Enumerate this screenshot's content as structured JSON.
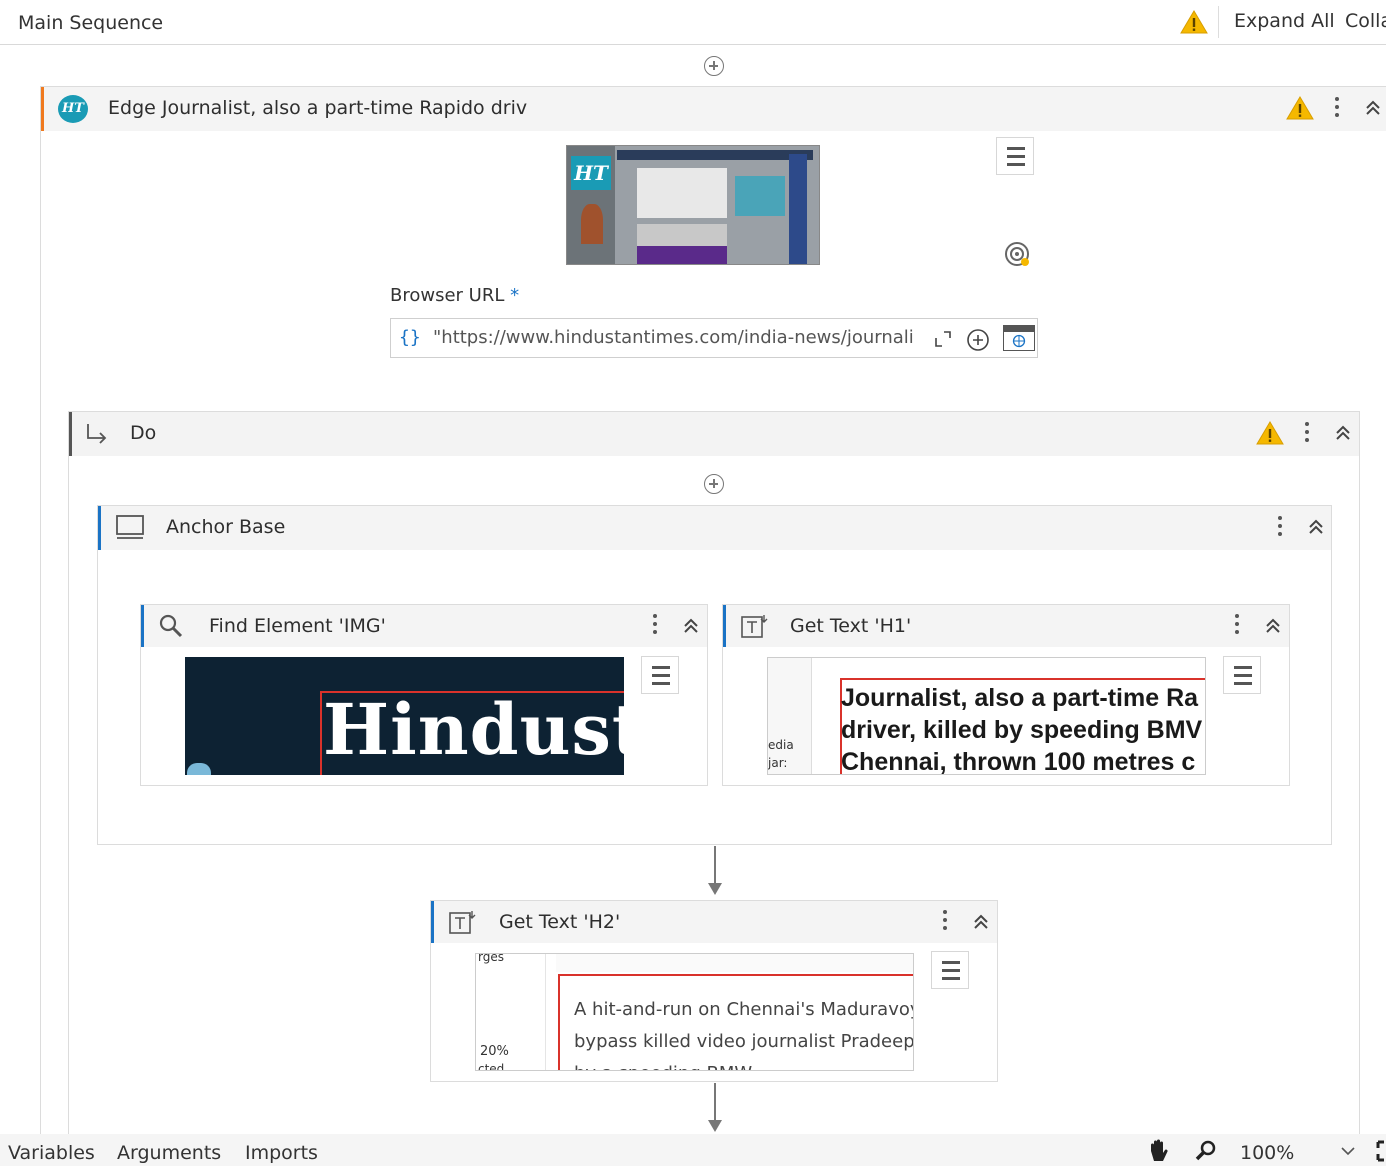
{
  "topbar": {
    "title": "Main Sequence",
    "expand_all": "Expand All",
    "collapse_all": "Collapse All"
  },
  "edge_scope": {
    "title": "Edge Journalist, also a part-time Rapido driv",
    "browser_url_label": "Browser URL",
    "required_marker": "*",
    "url_braces": "{}",
    "url_value": "\"https://www.hindustantimes.com/india-news/journali",
    "logo_text": "HT"
  },
  "do_scope": {
    "title": "Do"
  },
  "anchor_base": {
    "title": "Anchor Base"
  },
  "find_element": {
    "title": "Find Element 'IMG'",
    "thumb_text": "Hindusta"
  },
  "get_text_h1": {
    "title": "Get Text 'H1'",
    "thumb_side": [
      "edia",
      "jar:"
    ],
    "thumb_lines": [
      "Journalist, also a part-time Ra",
      "driver, killed by speeding BMV",
      "Chennai, thrown 100 metres c"
    ]
  },
  "get_text_h2": {
    "title": "Get Text 'H2'",
    "thumb_side": [
      "rges",
      "20%",
      "cted"
    ],
    "thumb_lines": [
      "A hit-and-run on Chennai's Maduravoy",
      "bypass killed video journalist Pradeep k",
      "by a speeding BMW"
    ]
  },
  "footer": {
    "tabs": [
      "Variables",
      "Arguments",
      "Imports"
    ],
    "zoom": "100%"
  },
  "colors": {
    "accent_blue": "#1a73c5",
    "accent_orange": "#f07a1f",
    "warning": "#f5b800",
    "thumb_dark": "#0d2233",
    "highlight_red": "#d9322b"
  }
}
